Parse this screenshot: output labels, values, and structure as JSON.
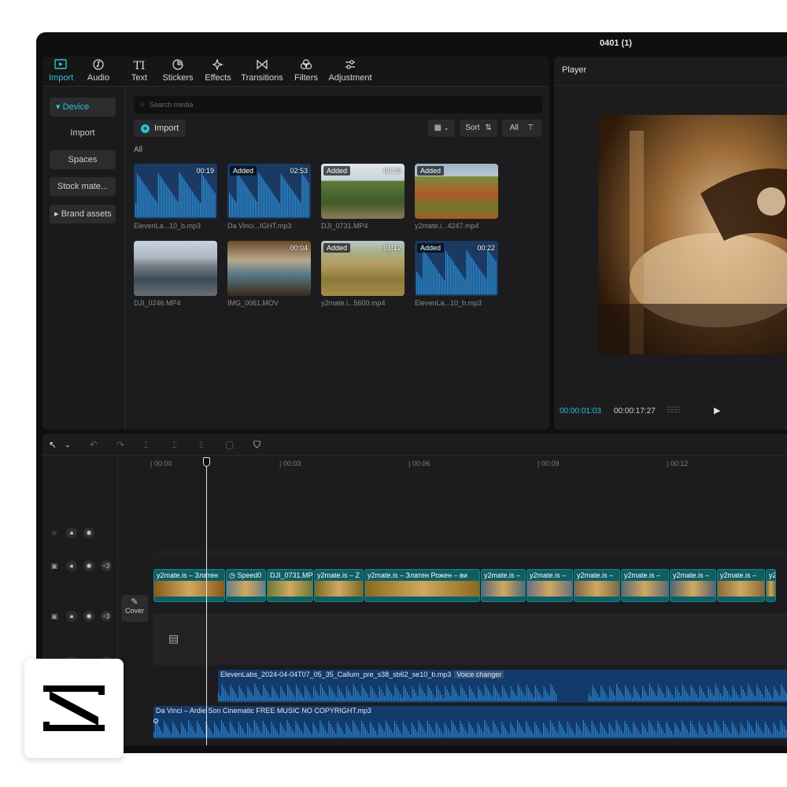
{
  "window": {
    "title": "0401 (1)"
  },
  "tool_tabs": [
    {
      "label": "Import",
      "icon": "import-icon"
    },
    {
      "label": "Audio",
      "icon": "music-note-icon"
    },
    {
      "label": "Text",
      "icon": "text-icon"
    },
    {
      "label": "Stickers",
      "icon": "sticker-icon"
    },
    {
      "label": "Effects",
      "icon": "sparkle-icon"
    },
    {
      "label": "Transitions",
      "icon": "bowtie-icon"
    },
    {
      "label": "Filters",
      "icon": "filters-icon"
    },
    {
      "label": "Adjustment",
      "icon": "sliders-icon"
    }
  ],
  "sidebar": {
    "items": [
      {
        "label": "▾ Device"
      },
      {
        "label": "Import"
      },
      {
        "label": "Spaces"
      },
      {
        "label": "Stock mate..."
      },
      {
        "label": "▸ Brand assets"
      }
    ]
  },
  "media": {
    "search_placeholder": "Search media",
    "import_label": "Import",
    "sort_label": "Sort",
    "filter_label": "All",
    "section_label": "All",
    "items": [
      {
        "name": "ElevenLa...10_b.mp3",
        "duration": "00:19",
        "added": "",
        "kind": "audio"
      },
      {
        "name": "Da Vinci...IGHT.mp3",
        "duration": "02:53",
        "added": "Added",
        "kind": "audio"
      },
      {
        "name": "DJI_0731.MP4",
        "duration": "00:20",
        "added": "Added",
        "kind": "vineyard"
      },
      {
        "name": "y2mate.i...4247.mp4",
        "duration": "",
        "added": "Added",
        "kind": "field"
      },
      {
        "name": "DJI_0246.MP4",
        "duration": "",
        "added": "",
        "kind": "street"
      },
      {
        "name": "IMG_0061.MOV",
        "duration": "00:04",
        "added": "",
        "kind": "room"
      },
      {
        "name": "y2mate.i...5600.mp4",
        "duration": "01:12",
        "added": "Added",
        "kind": "aerial"
      },
      {
        "name": "ElevenLa...10_b.mp3",
        "duration": "00:22",
        "added": "Added",
        "kind": "audio"
      }
    ]
  },
  "player": {
    "title": "Player",
    "current_time": "00:00:01:03",
    "total_time": "00:00:17:27"
  },
  "timeline": {
    "ruler": [
      "| 00:00",
      "| 00:03",
      "| 00:06",
      "| 00:09",
      "| 00:12"
    ],
    "cover_label": "Cover",
    "video_clips": [
      {
        "label": "y2mate.is – Златен",
        "color": "#8a5a1c"
      },
      {
        "label": "◷ Speed0",
        "color": "#6d7f8a"
      },
      {
        "label": "DJI_0731.MP",
        "color": "#6a7a3a"
      },
      {
        "label": "y2mate.is – Z",
        "color": "#7a6a2a"
      },
      {
        "label": "y2mate.is – Златен Рожен – ви",
        "color": "#8a6a1c"
      },
      {
        "label": "y2mate.is – ",
        "color": "#5a6a7a"
      },
      {
        "label": "y2mate.is – ",
        "color": "#6a7080"
      },
      {
        "label": "y2mate.is – ",
        "color": "#7a6a4a"
      },
      {
        "label": "y2mate.is – ",
        "color": "#606a74"
      },
      {
        "label": "y2mate.is – ",
        "color": "#5a6470"
      },
      {
        "label": "y2mate.is – ",
        "color": "#8a6a3a"
      },
      {
        "label": "y2",
        "color": "#7a6a3a"
      }
    ],
    "audio_clips": [
      {
        "label": "ElevenLabs_2024-04-04T07_05_35_Callum_pre_s38_sb62_se10_b.mp3",
        "tag": "Voice changer"
      },
      {
        "label": "Da Vinci – Ardie Son  Cinematic  FREE MUSIC NO COPYRIGHT.mp3",
        "tag": ""
      }
    ]
  },
  "colors": {
    "accent": "#27c3d5",
    "clip": "#0e5f64",
    "audio": "#123a6b"
  }
}
